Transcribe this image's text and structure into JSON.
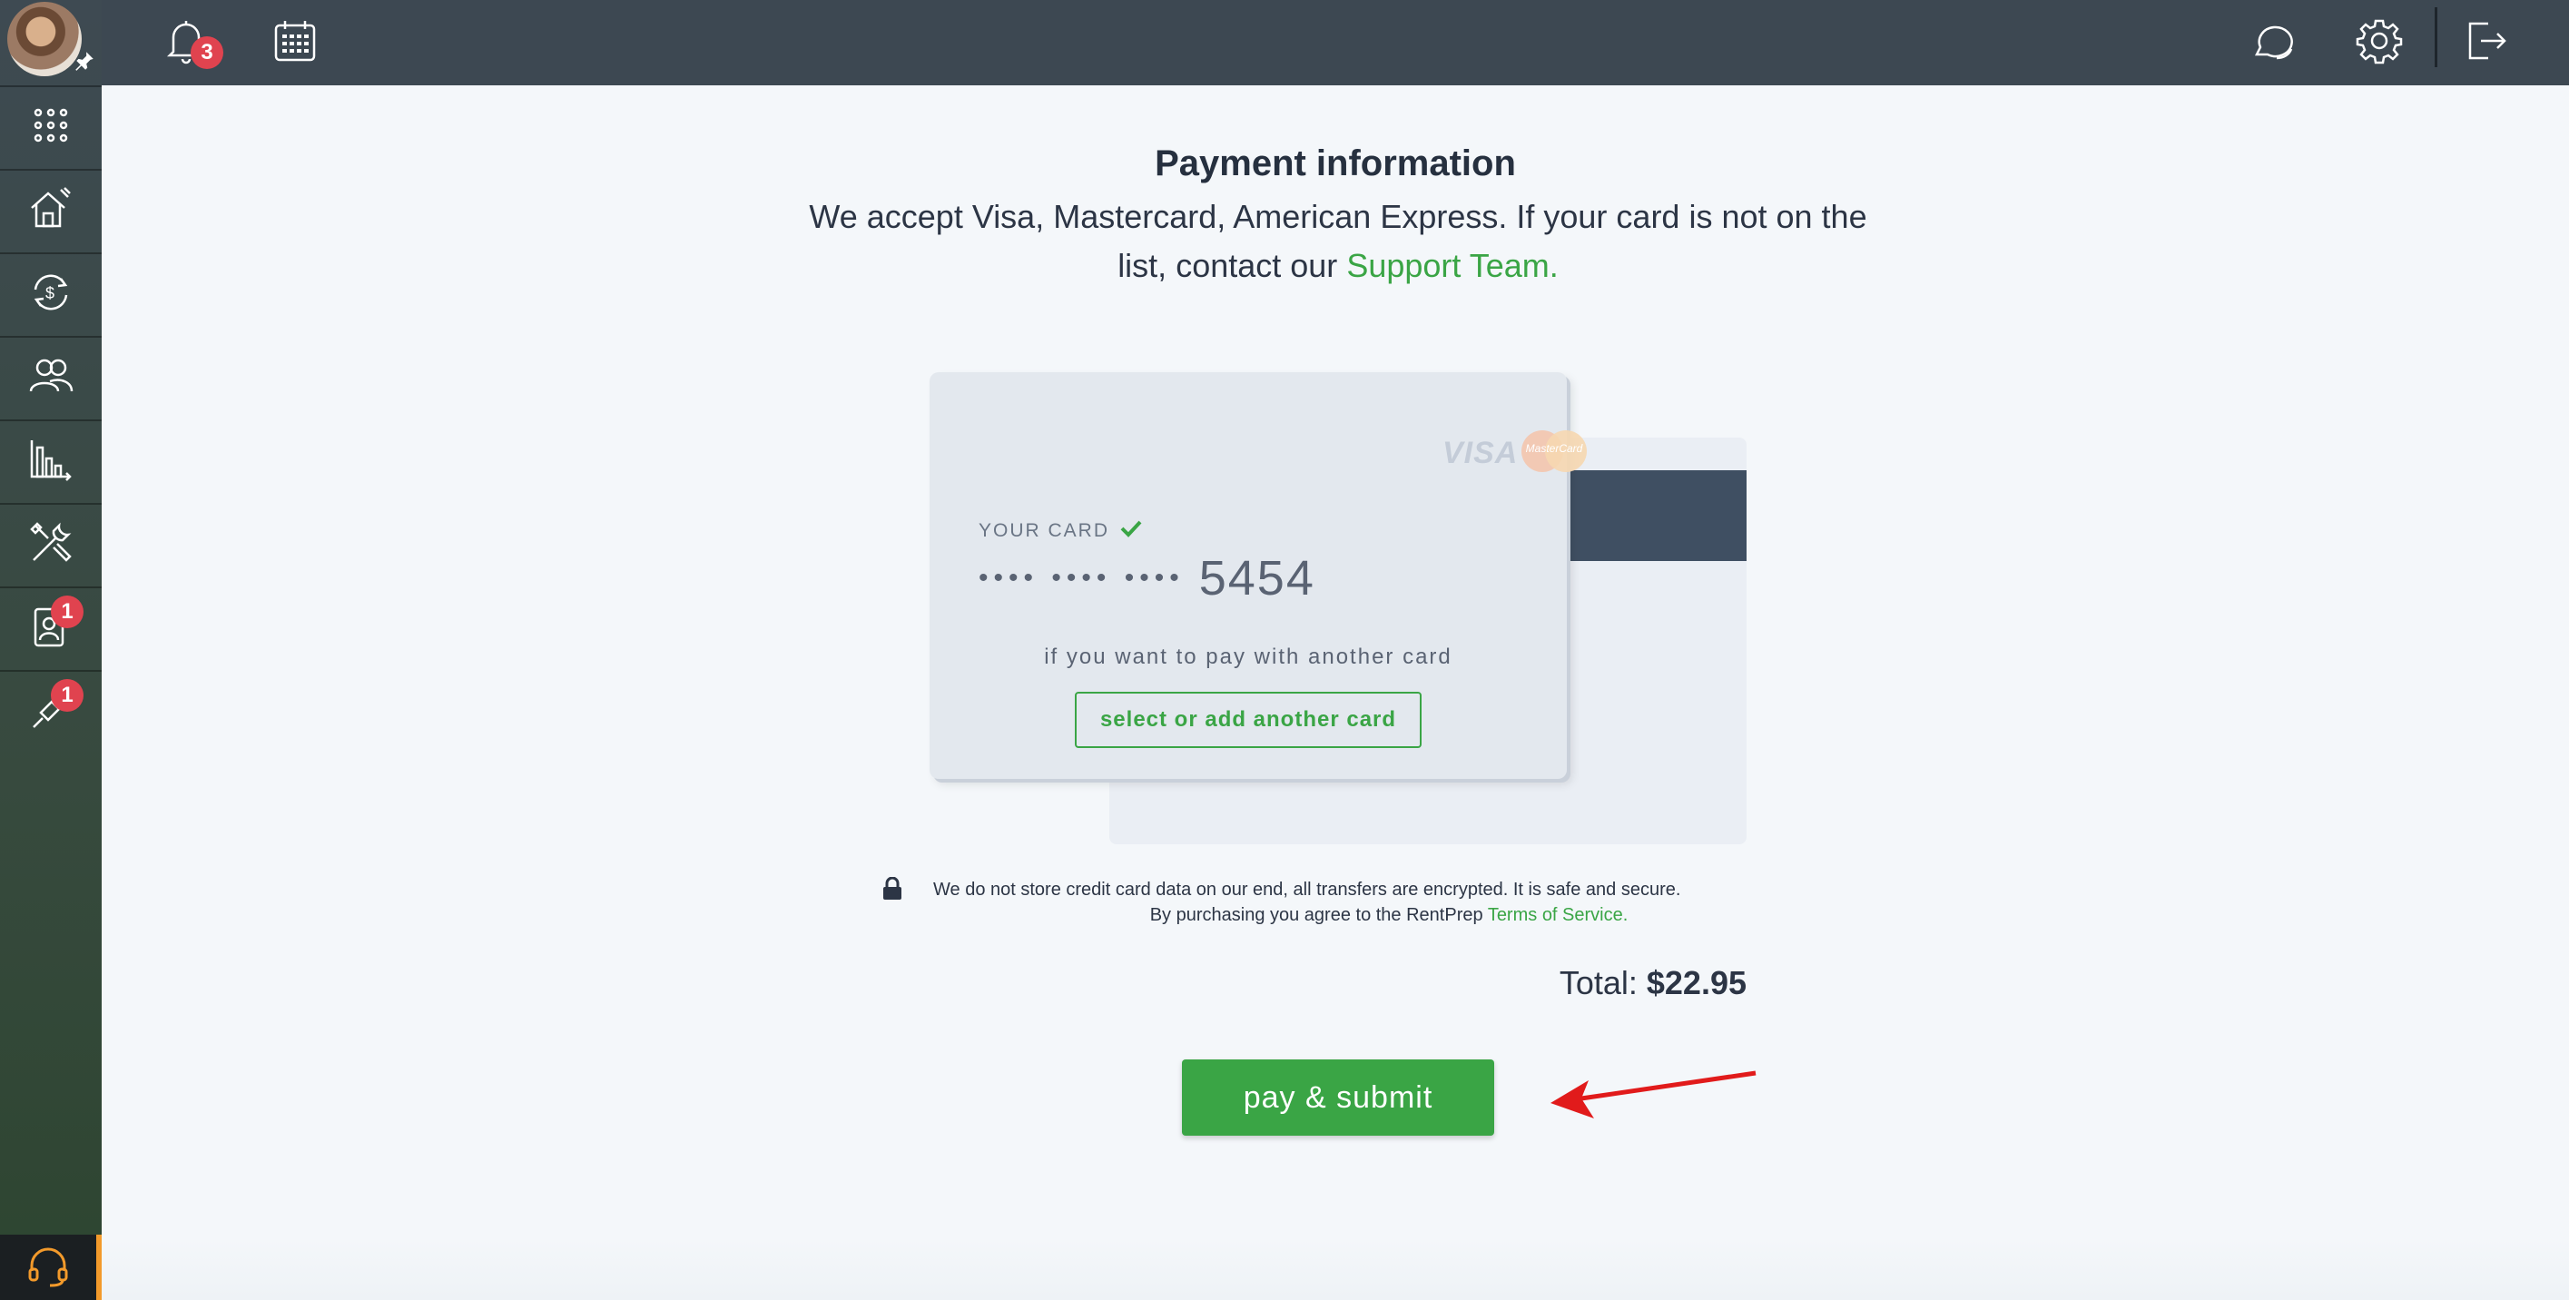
{
  "topbar": {
    "notifications_count": "3",
    "icons": [
      "bell-icon",
      "calendar-icon",
      "chat-icon",
      "gear-icon",
      "logout-icon"
    ]
  },
  "sidebar": {
    "items": [
      {
        "icon": "apps-grid-icon"
      },
      {
        "icon": "properties-icon"
      },
      {
        "icon": "payments-icon"
      },
      {
        "icon": "tenants-icon"
      },
      {
        "icon": "reports-icon"
      },
      {
        "icon": "maintenance-icon"
      },
      {
        "icon": "applicants-icon",
        "badge": "1"
      },
      {
        "icon": "screening-icon",
        "badge": "1"
      }
    ],
    "support_icon": "headset-icon"
  },
  "payment": {
    "title": "Payment information",
    "subtitle_text": "We accept Visa, Mastercard, American Express. If your card is not on the list, contact our",
    "support_link": "Support Team.",
    "card": {
      "label": "YOUR CARD",
      "masked": "•••• •••• ••••",
      "last4": "5454",
      "visa_logo": "VISA",
      "mastercard_logo": "MasterCard",
      "another_prompt": "if you want to pay with another card",
      "select_button": "select or add another card"
    },
    "secure_line1": "We do not store credit card data on our end, all transfers are encrypted. It is safe and secure.",
    "secure_line2": "By purchasing you agree to the RentPrep",
    "terms_link": "Terms of Service.",
    "total_label": "Total:",
    "total_value": "$22.95",
    "pay_button": "pay & submit"
  },
  "colors": {
    "accent_green": "#3aa545",
    "topbar": "#3d4852",
    "badge_red": "#e0434f",
    "annotation_arrow": "#e11b1b"
  }
}
